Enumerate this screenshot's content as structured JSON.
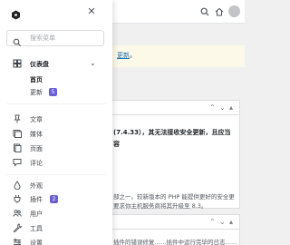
{
  "top": {
    "close_icon": "✕"
  },
  "search": {
    "placeholder": "搜索菜单"
  },
  "dashboard": {
    "label": "仪表盘",
    "sub": {
      "home": "首页",
      "updates": "更新",
      "updates_badge": "5"
    }
  },
  "menu": [
    {
      "label": "文章",
      "icon": "pin-icon"
    },
    {
      "label": "媒体",
      "icon": "media-icon"
    },
    {
      "label": "页面",
      "icon": "page-icon"
    },
    {
      "label": "评论",
      "icon": "comment-icon"
    },
    {
      "label": "外观",
      "icon": "appearance-icon"
    },
    {
      "label": "插件",
      "icon": "plugin-icon",
      "badge": "2"
    },
    {
      "label": "用户",
      "icon": "users-icon"
    },
    {
      "label": "工具",
      "icon": "tools-icon"
    },
    {
      "label": "设置",
      "icon": "settings-icon"
    }
  ],
  "background": {
    "notice_tail": "更新",
    "notice_end": "。",
    "card1": {
      "line1": "(7.4.33），其无法接收安全更新，且应当",
      "line1b": "容",
      "line2": "部之一。较新版本的 PHP 能提供更好的安全更",
      "line3": "要求你主机服务商将其升级至 8.3。"
    },
    "card2": {
      "line1": "插件的错误修复……插件中运行完毕的日志……"
    }
  },
  "colors": {
    "accent": "#6b5fd3",
    "notice": "#dba617",
    "link": "#2271b1"
  }
}
